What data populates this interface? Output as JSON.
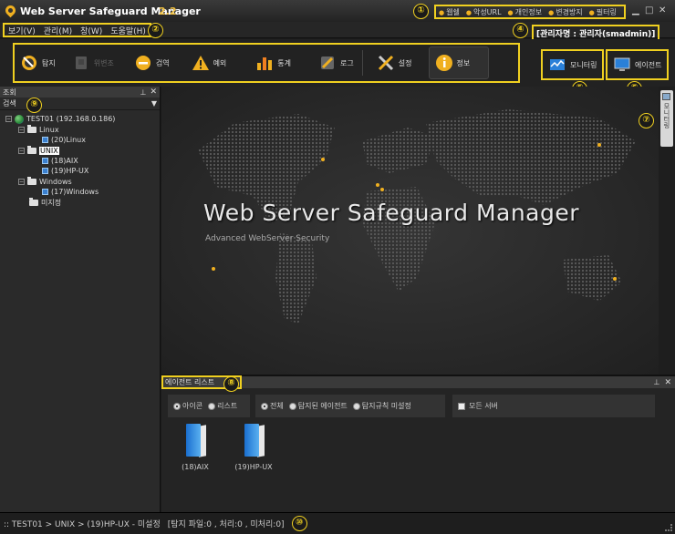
{
  "app": {
    "title": "Web Server Safeguard Manager",
    "version": "2.2"
  },
  "top_links": [
    "웹쉘",
    "악성URL",
    "개인정보",
    "변경방지",
    "필터링"
  ],
  "window_controls": {
    "minimize": "▁",
    "maximize": "□",
    "close": "✕"
  },
  "menu": [
    "보기(V)",
    "관리(M)",
    "창(W)",
    "도움말(H)"
  ],
  "admin_label": "[관리자명 : 관리자(smadmin)]",
  "toolbar": {
    "buttons": [
      {
        "label": "탐지",
        "icon": "detect-icon"
      },
      {
        "label": "위변조",
        "icon": "forgery-icon",
        "disabled": true
      },
      {
        "label": "검역",
        "icon": "quarantine-icon"
      },
      {
        "label": "예외",
        "icon": "warning-icon"
      },
      {
        "label": "통계",
        "icon": "stats-icon"
      },
      {
        "label": "로그",
        "icon": "log-icon"
      },
      {
        "label": "설정",
        "icon": "settings-icon"
      },
      {
        "label": "정보",
        "icon": "info-icon",
        "active": true
      }
    ],
    "monitoring": "모니터링",
    "agent": "에이전트"
  },
  "left_panel": {
    "title": "조회",
    "search_label": "검색",
    "tree": [
      {
        "label": "TEST01 (192.168.0.186)",
        "type": "root"
      },
      {
        "label": "Linux",
        "type": "folder"
      },
      {
        "label": "(20)Linux",
        "type": "server"
      },
      {
        "label": "UNIX",
        "type": "folder",
        "selected": true
      },
      {
        "label": "(18)AIX",
        "type": "server"
      },
      {
        "label": "(19)HP-UX",
        "type": "server"
      },
      {
        "label": "Windows",
        "type": "folder"
      },
      {
        "label": "(17)Windows",
        "type": "server"
      },
      {
        "label": "미지정",
        "type": "folder"
      }
    ]
  },
  "banner": {
    "title": "Web Server Safeguard Manager",
    "subtitle": "Advanced WebServer Security"
  },
  "right_tab": {
    "label": "모니터링"
  },
  "agent_panel": {
    "title": "에이전트 리스트",
    "view_options": [
      "아이콘",
      "리스트"
    ],
    "view_selected": 0,
    "filter_options": [
      "전체",
      "탐지된 에이전트",
      "탐지규칙 미설정"
    ],
    "filter_selected": 0,
    "all_servers_label": "모든 서버",
    "agents": [
      "(18)AIX",
      "(19)HP-UX"
    ]
  },
  "status": {
    "path": ":: TEST01 > UNIX > (19)HP-UX - 미설정",
    "counts": "[탐지 파일:0 , 처리:0 , 미처리:0]"
  },
  "annotations": [
    "①",
    "②",
    "③",
    "④",
    "⑤",
    "⑥",
    "⑦",
    "⑧",
    "⑨",
    "⑩"
  ],
  "colors": {
    "accent": "#f0d020",
    "brand_orange": "#f0b020",
    "background": "#1a1a1a"
  }
}
